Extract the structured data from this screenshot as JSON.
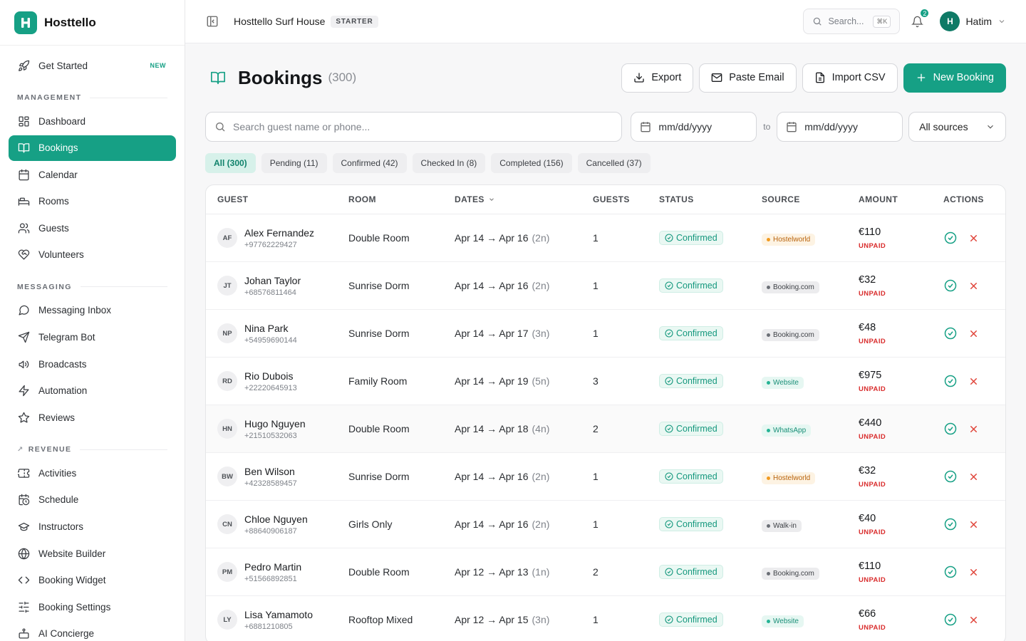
{
  "brand": {
    "name": "Hosttello"
  },
  "sidebar": {
    "get_started": {
      "label": "Get Started",
      "badge": "NEW"
    },
    "sections": [
      {
        "title": "MANAGEMENT",
        "items": [
          {
            "label": "Dashboard",
            "icon": "dashboard-icon",
            "active": false
          },
          {
            "label": "Bookings",
            "icon": "book-open-icon",
            "active": true
          },
          {
            "label": "Calendar",
            "icon": "calendar-icon",
            "active": false
          },
          {
            "label": "Rooms",
            "icon": "bed-icon",
            "active": false
          },
          {
            "label": "Guests",
            "icon": "users-icon",
            "active": false
          },
          {
            "label": "Volunteers",
            "icon": "heart-handshake-icon",
            "active": false
          }
        ]
      },
      {
        "title": "MESSAGING",
        "items": [
          {
            "label": "Messaging Inbox",
            "icon": "message-circle-icon",
            "active": false
          },
          {
            "label": "Telegram Bot",
            "icon": "send-icon",
            "active": false
          },
          {
            "label": "Broadcasts",
            "icon": "megaphone-icon",
            "active": false
          },
          {
            "label": "Automation",
            "icon": "zap-icon",
            "active": false
          },
          {
            "label": "Reviews",
            "icon": "star-icon",
            "active": false
          }
        ]
      },
      {
        "title": "REVENUE",
        "items": [
          {
            "label": "Activities",
            "icon": "ticket-icon",
            "active": false
          },
          {
            "label": "Schedule",
            "icon": "calendar-clock-icon",
            "active": false
          },
          {
            "label": "Instructors",
            "icon": "graduation-cap-icon",
            "active": false
          },
          {
            "label": "Website Builder",
            "icon": "globe-icon",
            "active": false
          },
          {
            "label": "Booking Widget",
            "icon": "code-icon",
            "active": false
          },
          {
            "label": "Booking Settings",
            "icon": "sliders-icon",
            "active": false
          },
          {
            "label": "AI Concierge",
            "icon": "bot-icon",
            "active": false
          }
        ]
      }
    ]
  },
  "topbar": {
    "property": "Hosttello Surf House",
    "plan": "STARTER",
    "search_placeholder": "Search...",
    "shortcut": "⌘K",
    "notifications": "2",
    "user_initial": "H",
    "user_name": "Hatim"
  },
  "page": {
    "title": "Bookings",
    "count": "(300)"
  },
  "actions": {
    "export": "Export",
    "paste_email": "Paste Email",
    "import_csv": "Import CSV",
    "new_booking": "New Booking"
  },
  "filters": {
    "search_placeholder": "Search guest name or phone...",
    "date_from_placeholder": "mm/dd/yyyy",
    "to_label": "to",
    "date_to_placeholder": "mm/dd/yyyy",
    "source": "All sources"
  },
  "tabs": [
    {
      "label": "All (300)",
      "active": true
    },
    {
      "label": "Pending (11)",
      "active": false
    },
    {
      "label": "Confirmed (42)",
      "active": false
    },
    {
      "label": "Checked In (8)",
      "active": false
    },
    {
      "label": "Completed (156)",
      "active": false
    },
    {
      "label": "Cancelled (37)",
      "active": false
    }
  ],
  "table": {
    "headers": {
      "guest": "GUEST",
      "room": "ROOM",
      "dates": "DATES",
      "guests": "GUESTS",
      "status": "STATUS",
      "source": "SOURCE",
      "amount": "AMOUNT",
      "actions": "ACTIONS"
    },
    "source_colors": {
      "Hostelworld": {
        "bg": "#fdf3e3",
        "fg": "#b8620b",
        "dot": "#f29a1f"
      },
      "Booking.com": {
        "bg": "#ececee",
        "fg": "#3f4247",
        "dot": "#6b6f76"
      },
      "Website": {
        "bg": "#e6f7f2",
        "fg": "#1a8f78",
        "dot": "#25b394"
      },
      "WhatsApp": {
        "bg": "#e6f7f2",
        "fg": "#1a8f78",
        "dot": "#25b394"
      },
      "Walk-in": {
        "bg": "#ececee",
        "fg": "#3f4247",
        "dot": "#6b6f76"
      }
    },
    "rows": [
      {
        "initials": "AF",
        "name": "Alex Fernandez",
        "phone": "+97762229427",
        "room": "Double Room",
        "dates": "Apr 14 → Apr 16",
        "nights": "(2n)",
        "guests": "1",
        "status": "Confirmed",
        "source": "Hostelworld",
        "amount": "€110",
        "payment": "UNPAID"
      },
      {
        "initials": "JT",
        "name": "Johan Taylor",
        "phone": "+68576811464",
        "room": "Sunrise Dorm",
        "dates": "Apr 14 → Apr 16",
        "nights": "(2n)",
        "guests": "1",
        "status": "Confirmed",
        "source": "Booking.com",
        "amount": "€32",
        "payment": "UNPAID"
      },
      {
        "initials": "NP",
        "name": "Nina Park",
        "phone": "+54959690144",
        "room": "Sunrise Dorm",
        "dates": "Apr 14 → Apr 17",
        "nights": "(3n)",
        "guests": "1",
        "status": "Confirmed",
        "source": "Booking.com",
        "amount": "€48",
        "payment": "UNPAID"
      },
      {
        "initials": "RD",
        "name": "Rio Dubois",
        "phone": "+22220645913",
        "room": "Family Room",
        "dates": "Apr 14 → Apr 19",
        "nights": "(5n)",
        "guests": "3",
        "status": "Confirmed",
        "source": "Website",
        "amount": "€975",
        "payment": "UNPAID"
      },
      {
        "initials": "HN",
        "name": "Hugo Nguyen",
        "phone": "+21510532063",
        "room": "Double Room",
        "dates": "Apr 14 → Apr 18",
        "nights": "(4n)",
        "guests": "2",
        "status": "Confirmed",
        "source": "WhatsApp",
        "amount": "€440",
        "payment": "UNPAID"
      },
      {
        "initials": "BW",
        "name": "Ben Wilson",
        "phone": "+42328589457",
        "room": "Sunrise Dorm",
        "dates": "Apr 14 → Apr 16",
        "nights": "(2n)",
        "guests": "1",
        "status": "Confirmed",
        "source": "Hostelworld",
        "amount": "€32",
        "payment": "UNPAID"
      },
      {
        "initials": "CN",
        "name": "Chloe Nguyen",
        "phone": "+88640906187",
        "room": "Girls Only",
        "dates": "Apr 14 → Apr 16",
        "nights": "(2n)",
        "guests": "1",
        "status": "Confirmed",
        "source": "Walk-in",
        "amount": "€40",
        "payment": "UNPAID"
      },
      {
        "initials": "PM",
        "name": "Pedro Martin",
        "phone": "+51566892851",
        "room": "Double Room",
        "dates": "Apr 12 → Apr 13",
        "nights": "(1n)",
        "guests": "2",
        "status": "Confirmed",
        "source": "Booking.com",
        "amount": "€110",
        "payment": "UNPAID"
      },
      {
        "initials": "LY",
        "name": "Lisa Yamamoto",
        "phone": "+6881210805",
        "room": "Rooftop Mixed",
        "dates": "Apr 12 → Apr 15",
        "nights": "(3n)",
        "guests": "1",
        "status": "Confirmed",
        "source": "Website",
        "amount": "€66",
        "payment": "UNPAID"
      }
    ]
  }
}
